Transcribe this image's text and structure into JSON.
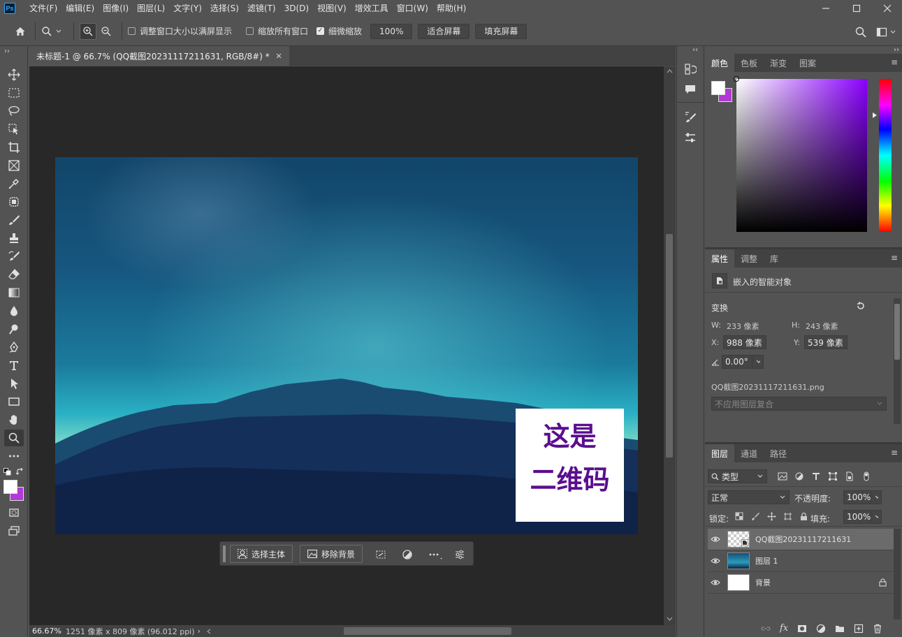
{
  "app": {
    "logo": "Ps"
  },
  "menu": [
    "文件(F)",
    "编辑(E)",
    "图像(I)",
    "图层(L)",
    "文字(Y)",
    "选择(S)",
    "滤镜(T)",
    "3D(D)",
    "视图(V)",
    "增效工具",
    "窗口(W)",
    "帮助(H)"
  ],
  "window_icons": [
    "minimize-icon",
    "maximize-icon",
    "close-icon"
  ],
  "options": {
    "resize_windows": {
      "label": "调整窗口大小以满屏显示",
      "checked": false
    },
    "zoom_all": {
      "label": "缩放所有窗口",
      "checked": false
    },
    "scrubby_zoom": {
      "label": "细微缩放",
      "checked": true
    },
    "zoom_value": "100%",
    "fit_screen": "适合屏幕",
    "fill_screen": "填充屏幕"
  },
  "document": {
    "tab_title": "未标题-1 @ 66.7% (QQ截图20231117211631, RGB/8#) *",
    "zoom": "66.67%",
    "info": "1251 像素 x 809 像素 (96.012 ppi)",
    "overlay_line1": "这是",
    "overlay_line2": "二维码"
  },
  "context_bar": {
    "select_subject": "选择主体",
    "remove_bg": "移除背景"
  },
  "color_panel": {
    "tabs": [
      "颜色",
      "色板",
      "渐变",
      "图案"
    ],
    "fg_color": "#ffffff",
    "bg_color": "#b03ad6",
    "hue_color": "#8a00ff"
  },
  "properties": {
    "tabs": [
      "属性",
      "调整",
      "库"
    ],
    "type": "嵌入的智能对象",
    "transform_label": "变换",
    "w_label": "W:",
    "w": "233 像素",
    "h_label": "H:",
    "h": "243 像素",
    "x_label": "X:",
    "x": "988 像素",
    "y_label": "Y:",
    "y": "539 像素",
    "angle": "0.00°",
    "file": "QQ截图20231117211631.png",
    "comp": "不应用图层复合"
  },
  "layers_panel": {
    "tabs": [
      "图层",
      "通道",
      "路径"
    ],
    "filter": "类型",
    "blend_mode": "正常",
    "opacity_label": "不透明度:",
    "opacity": "100%",
    "lock_label": "锁定:",
    "fill_label": "填充:",
    "fill": "100%",
    "layers": [
      {
        "name": "QQ截图20231117211631",
        "selected": true
      },
      {
        "name": "图层 1",
        "selected": false
      },
      {
        "name": "背景",
        "selected": false,
        "locked": true
      }
    ]
  }
}
